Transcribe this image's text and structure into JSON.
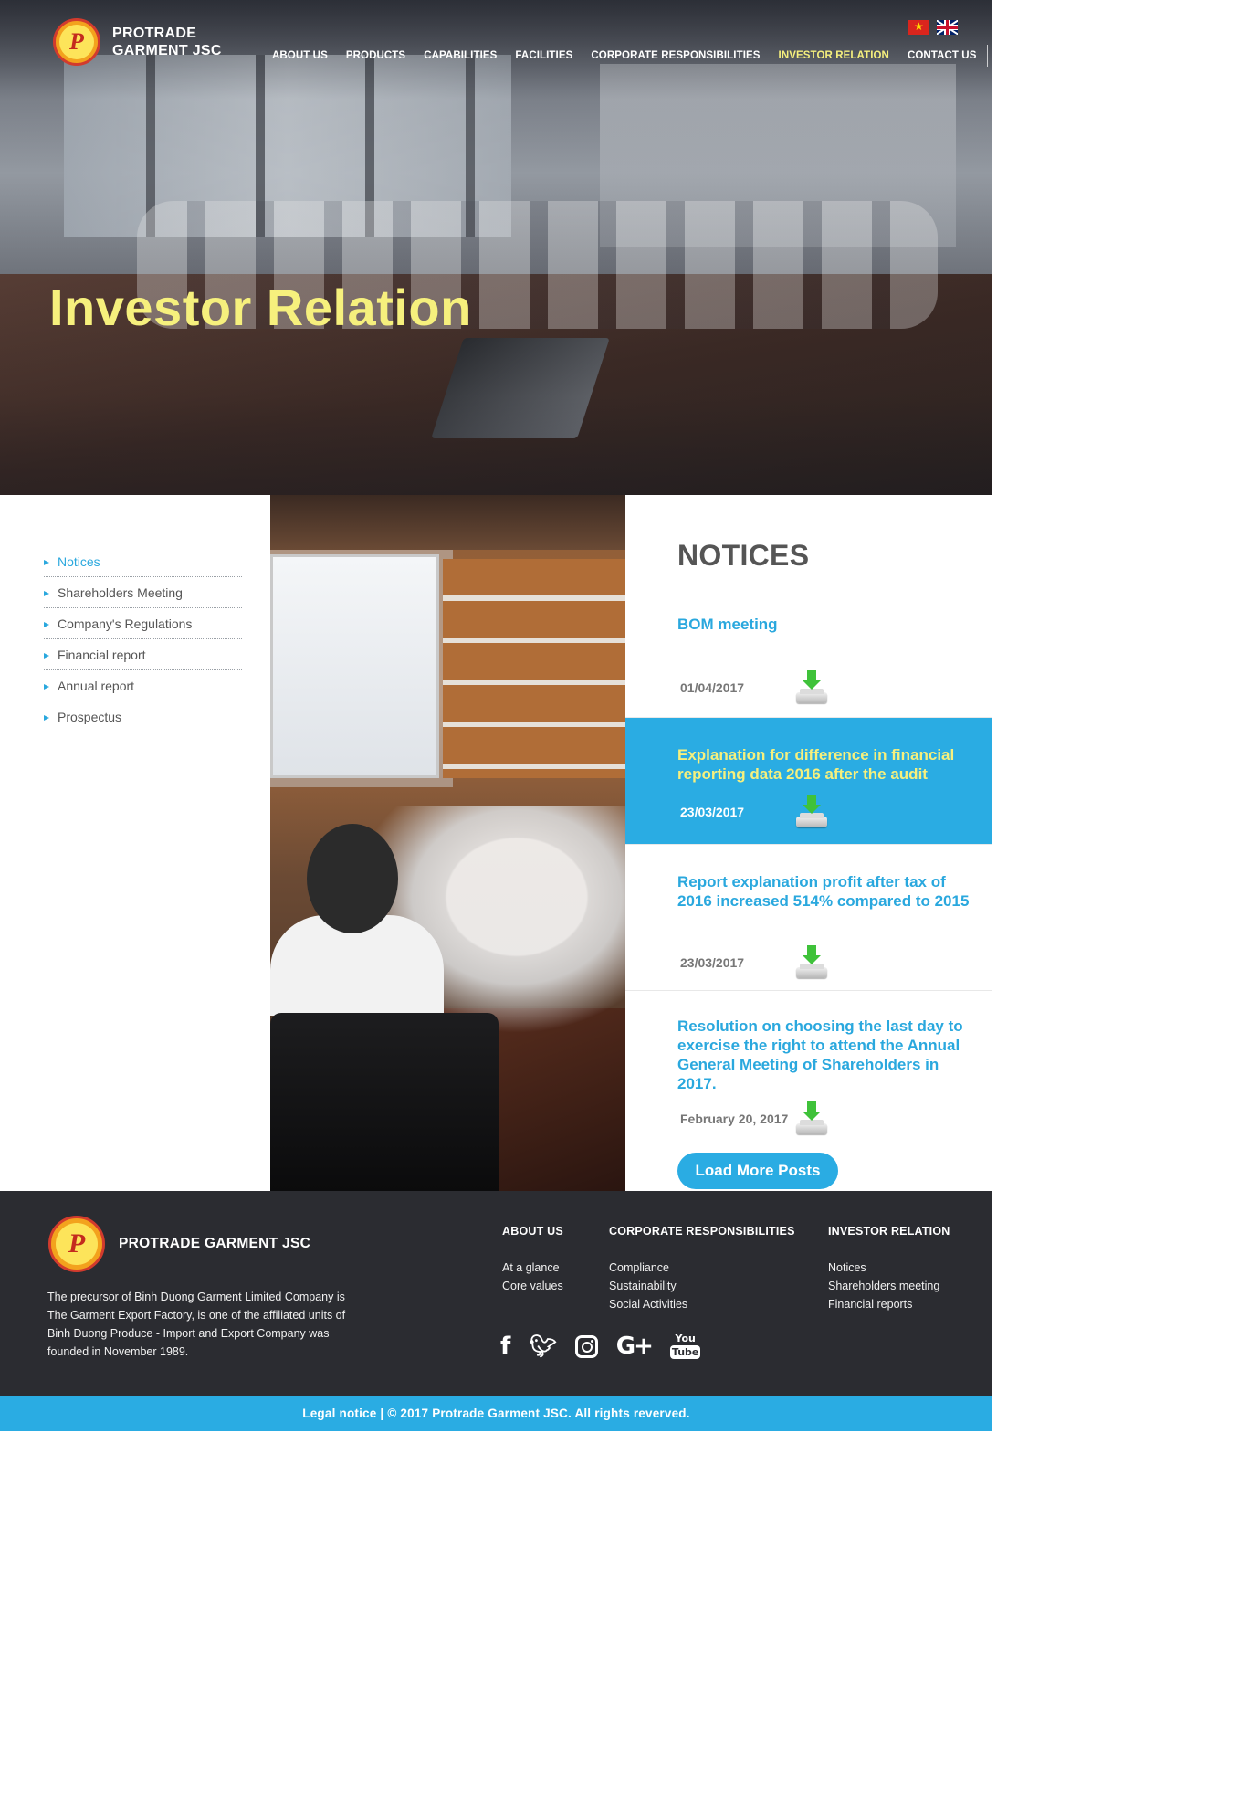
{
  "brand": {
    "line1": "PROTRADE",
    "line2": "GARMENT JSC",
    "logo_letter": "P"
  },
  "languages": [
    "vietnamese-flag",
    "english-flag"
  ],
  "nav": {
    "items": [
      "ABOUT US",
      "PRODUCTS",
      "CAPABILITIES",
      "FACILITIES",
      "CORPORATE RESPONSIBILITIES",
      "INVESTOR RELATION",
      "CONTACT US"
    ],
    "active": "INVESTOR RELATION"
  },
  "hero": {
    "title": "Investor Relation"
  },
  "sidebar": {
    "items": [
      {
        "label": "Notices",
        "active": true
      },
      {
        "label": "Shareholders Meeting",
        "active": false
      },
      {
        "label": "Company's Regulations",
        "active": false
      },
      {
        "label": "Financial report",
        "active": false
      },
      {
        "label": "Annual report",
        "active": false
      },
      {
        "label": "Prospectus",
        "active": false
      }
    ]
  },
  "notices": {
    "heading": "NOTICES",
    "items": [
      {
        "title": "BOM meeting",
        "date": "01/04/2017",
        "icon": "download-icon"
      },
      {
        "title": "Explanation for difference in financial reporting data 2016 after the audit",
        "date": "23/03/2017",
        "icon": "download-icon",
        "highlighted": true
      },
      {
        "title": "Report explanation profit after tax of 2016 increased 514% compared to 2015",
        "date": "23/03/2017",
        "icon": "download-icon"
      },
      {
        "title": "Resolution on choosing the last day to exercise the right to attend the Annual General Meeting of Shareholders in 2017.",
        "date": "February 20, 2017",
        "icon": "download-icon"
      }
    ],
    "load_more": "Load More Posts"
  },
  "footer": {
    "brand": "PROTRADE GARMENT JSC",
    "about": "The precursor of Binh Duong Garment Limited Company is The Garment Export Factory, is one of the affiliated units of Binh Duong Produce - Import and Export Company was founded in November 1989.",
    "columns": [
      {
        "heading": "ABOUT US",
        "links": [
          "At a glance",
          "Core values"
        ]
      },
      {
        "heading": "CORPORATE RESPONSIBILITIES",
        "links": [
          "Compliance",
          "Sustainability",
          "Social Activities"
        ]
      },
      {
        "heading": "INVESTOR RELATION",
        "links": [
          "Notices",
          "Shareholders meeting",
          "Financial reports"
        ]
      }
    ],
    "social": [
      "facebook-icon",
      "twitter-icon",
      "instagram-icon",
      "google-plus-icon",
      "youtube-icon"
    ],
    "youtube_label": {
      "you": "You",
      "tube": "Tube"
    },
    "legal": "Legal notice | © 2017 Protrade Garment JSC. All rights reverved."
  },
  "colors": {
    "accent": "#2aace3",
    "highlight_text": "#f6f07d",
    "footer_bg": "#2b2c31"
  }
}
